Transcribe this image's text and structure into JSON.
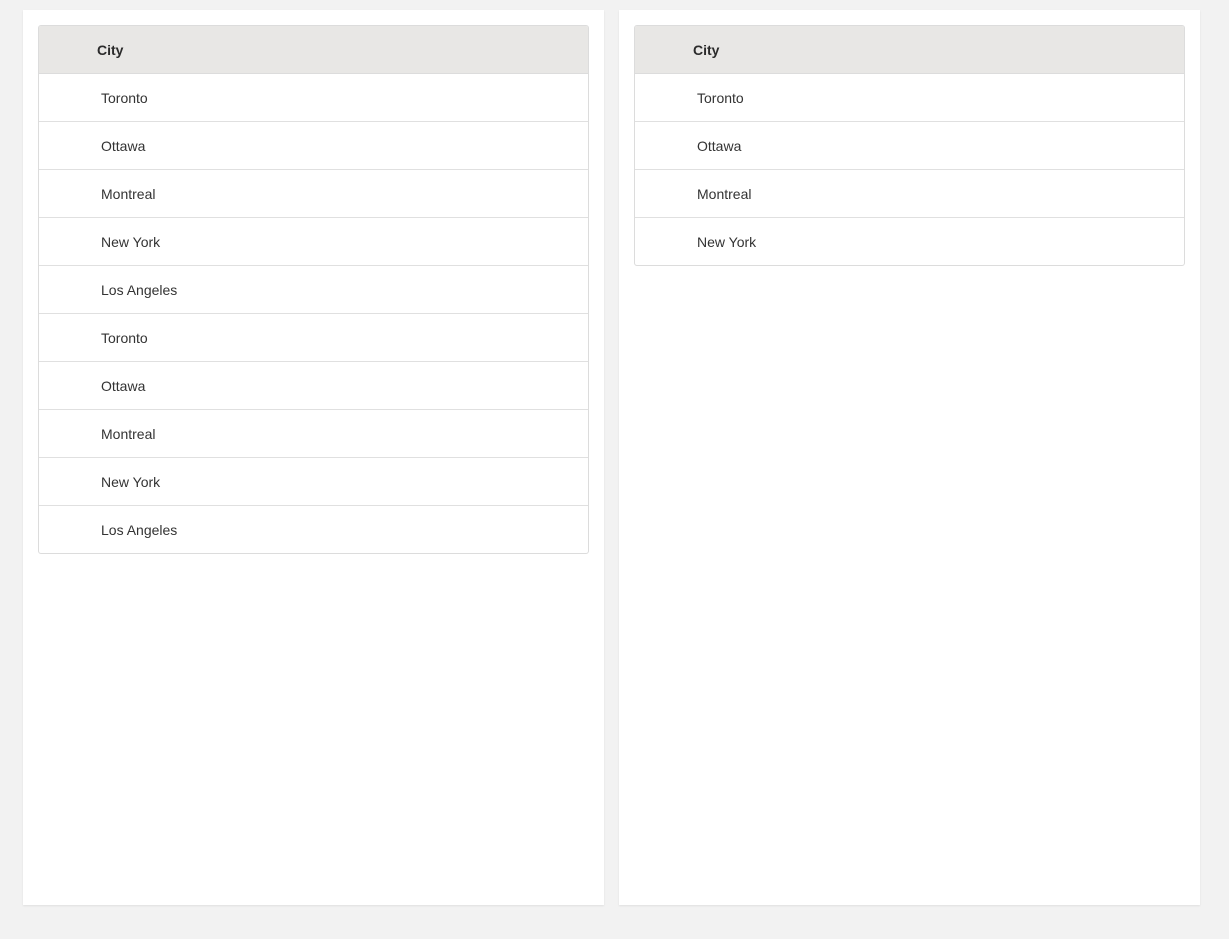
{
  "left_grid": {
    "header": "City",
    "rows": [
      "Toronto",
      "Ottawa",
      "Montreal",
      "New York",
      "Los Angeles",
      "Toronto",
      "Ottawa",
      "Montreal",
      "New York",
      "Los Angeles"
    ]
  },
  "right_grid": {
    "header": "City",
    "rows": [
      "Toronto",
      "Ottawa",
      "Montreal",
      "New York"
    ]
  }
}
